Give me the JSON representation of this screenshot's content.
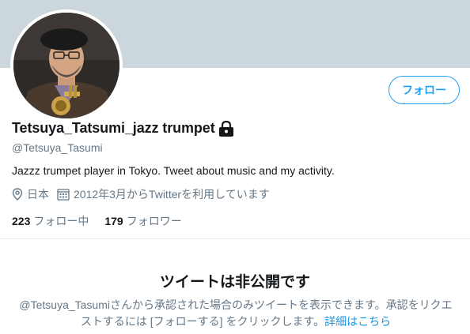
{
  "profile": {
    "display_name": "Tetsuya_Tatsumi_jazz trumpet",
    "handle": "@Tetsuya_Tasumi",
    "bio": "Jazzz trumpet player in Tokyo. Tweet about music and my activity.",
    "location": "日本",
    "joined": "2012年3月からTwitterを利用しています",
    "avatar_alt": "profile photo",
    "protected_icon": "lock-icon"
  },
  "actions": {
    "follow_label": "フォロー"
  },
  "counts": {
    "following_num": "223",
    "following_label": "フォロー中",
    "followers_num": "179",
    "followers_label": "フォロワー"
  },
  "protected": {
    "title": "ツイートは非公開です",
    "description": "@Tetsuya_Tasumiさんから承認された場合のみツイートを表示できます。承認をリクエストするには [フォローする] をクリックします。",
    "learn_more": "詳細はこちら"
  },
  "colors": {
    "banner": "#ccd6dd",
    "accent": "#1da1f2",
    "secondary_text": "#657786"
  },
  "icons": [
    "location-pin-icon",
    "calendar-icon",
    "lock-icon"
  ]
}
